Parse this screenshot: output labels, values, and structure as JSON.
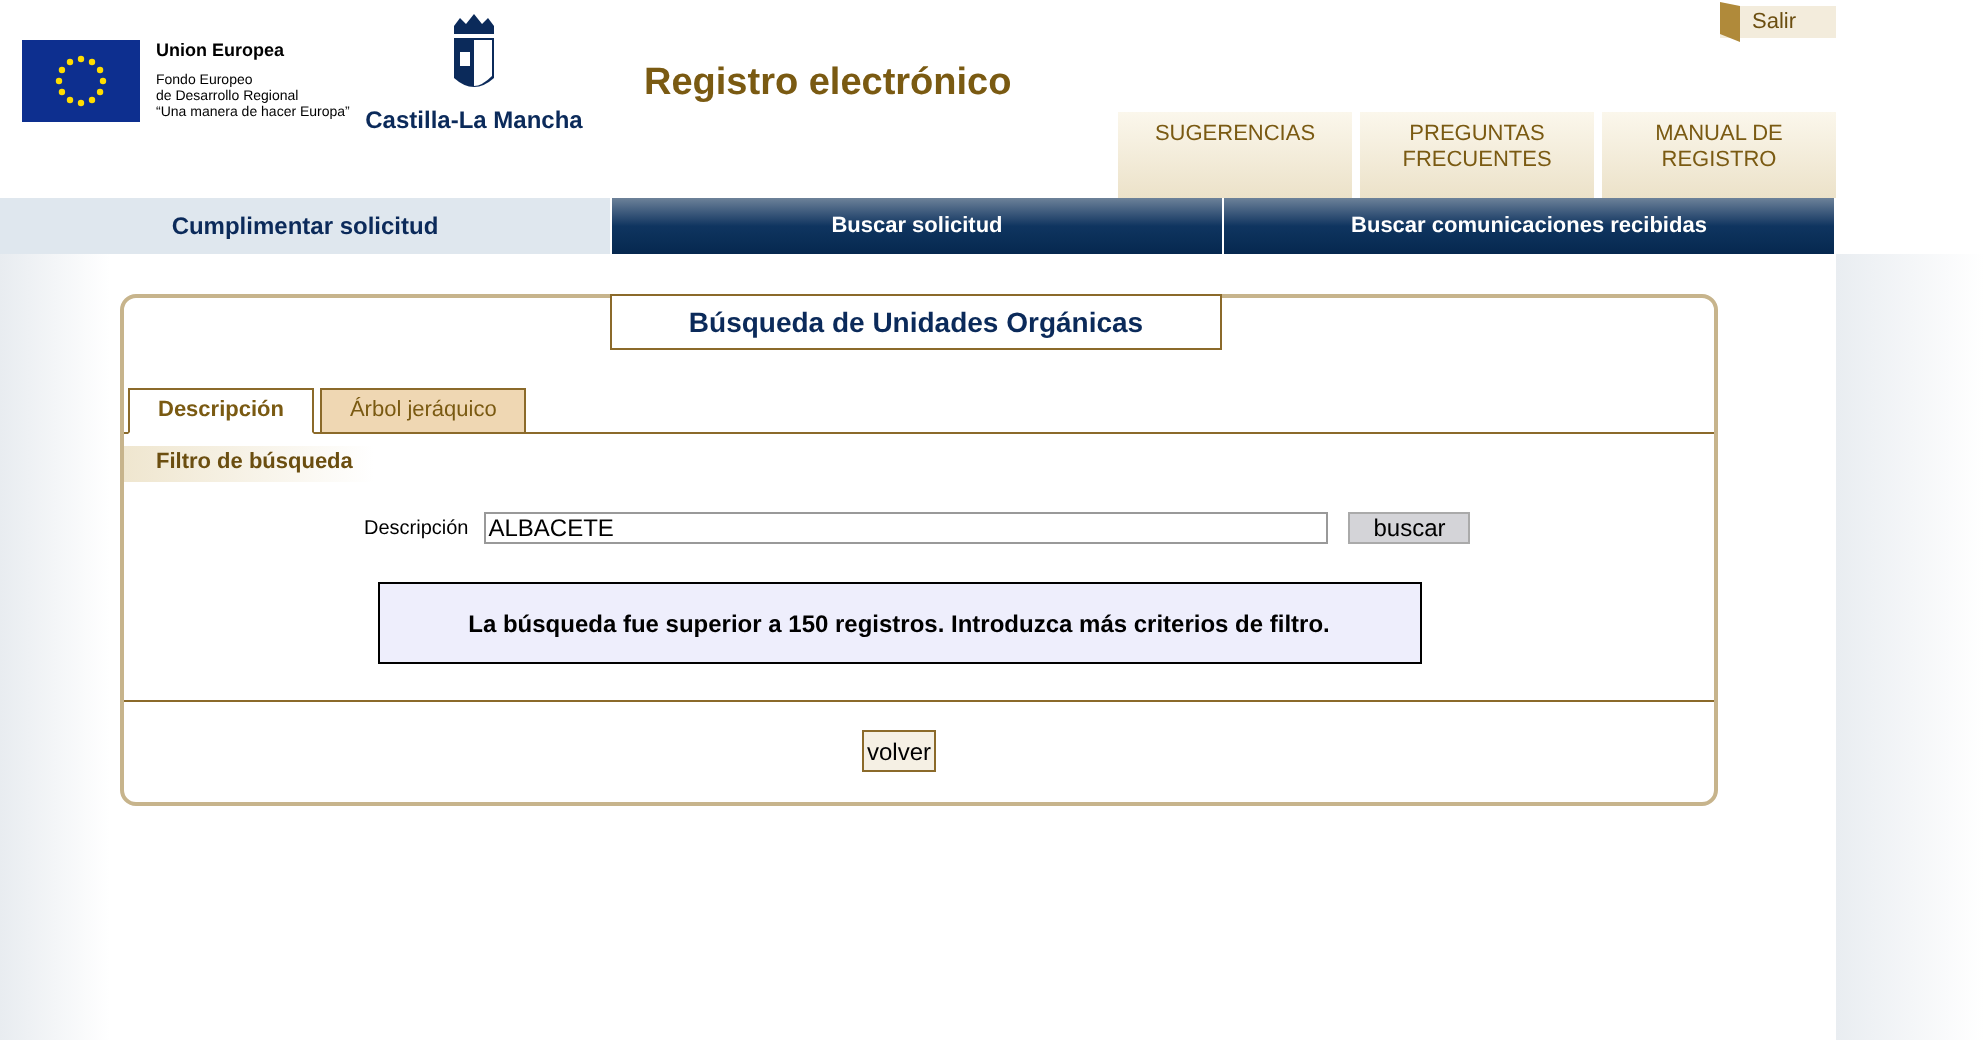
{
  "header": {
    "eu_title": "Union Europea",
    "eu_lines": [
      "Fondo Europeo",
      "de Desarrollo Regional",
      "“Una manera de hacer Europa”"
    ],
    "region_name": "Castilla-La Mancha",
    "site_title": "Registro electrónico",
    "exit_link": "Salir",
    "top_links": [
      {
        "label": "SUGERENCIAS"
      },
      {
        "label": "PREGUNTAS FRECUENTES"
      },
      {
        "label": "MANUAL DE REGISTRO"
      }
    ]
  },
  "nav_tabs": [
    {
      "label": "Cumplimentar solicitud",
      "selected": true
    },
    {
      "label": "Buscar solicitud",
      "selected": false
    },
    {
      "label": "Buscar comunicaciones recibidas",
      "selected": false
    }
  ],
  "panel": {
    "title": "Búsqueda de Unidades Orgánicas",
    "tabs": [
      {
        "label": "Descripción",
        "selected": true
      },
      {
        "label": "Árbol jeráquico",
        "selected": false
      }
    ],
    "section_label": "Filtro de búsqueda",
    "field": {
      "label": "Descripción",
      "value": "ALBACETE"
    },
    "search_button": "buscar",
    "message": "La búsqueda fue superior a 150 registros. Introduzca más criterios de filtro.",
    "back_button": "volver"
  }
}
